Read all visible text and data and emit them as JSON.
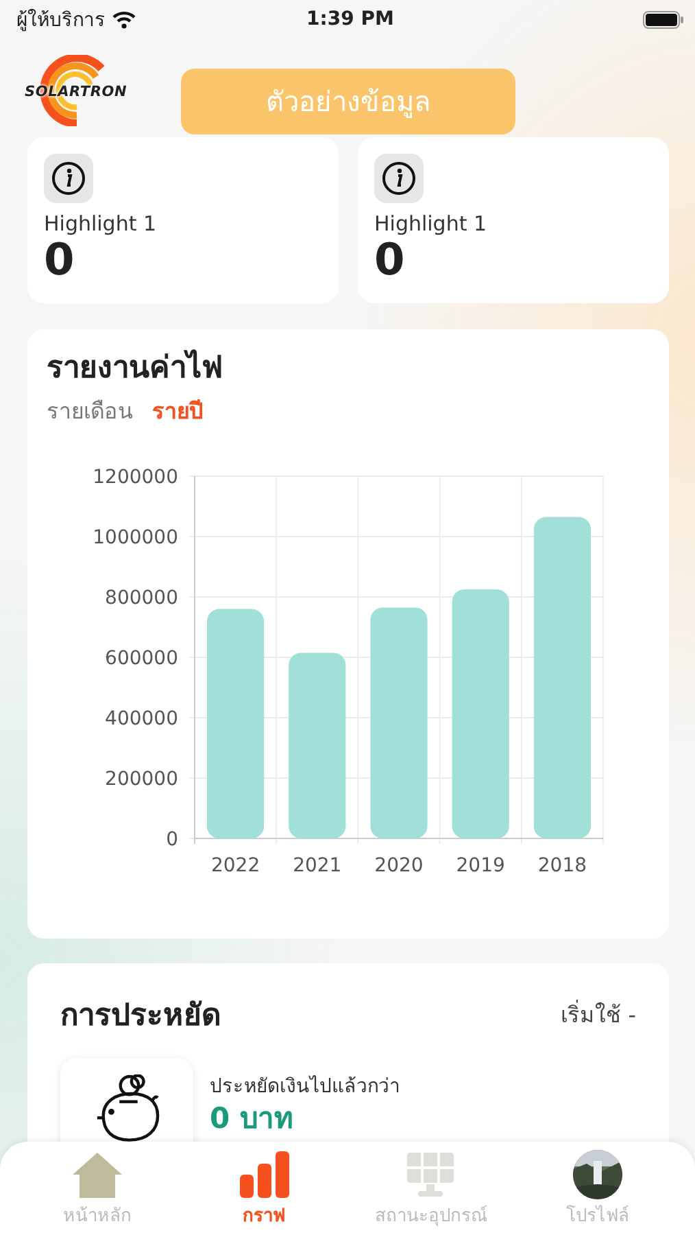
{
  "status_bar": {
    "carrier": "ผู้ให้บริการ",
    "time": "1:39 PM"
  },
  "header": {
    "logo": "SOLARTRON",
    "sample_button": "ตัวอย่างข้อมูล"
  },
  "highlights": [
    {
      "label": "Highlight 1",
      "value": "0"
    },
    {
      "label": "Highlight 1",
      "value": "0"
    }
  ],
  "report": {
    "title": "รายงานค่าไฟ",
    "tabs": [
      {
        "label": "รายเดือน",
        "selected": false
      },
      {
        "label": "รายปี",
        "selected": true
      }
    ],
    "chart_data": {
      "type": "bar",
      "categories": [
        "2022",
        "2021",
        "2020",
        "2019",
        "2018"
      ],
      "grid": true,
      "series": [
        {
          "color": "#a0e0d8",
          "values": [
            760000,
            615000,
            765000,
            825000,
            1065000
          ]
        }
      ],
      "ylim": [
        0,
        1200000
      ],
      "yticks": [
        0,
        200000,
        400000,
        600000,
        800000,
        1000000,
        1200000
      ]
    }
  },
  "savings": {
    "title": "การประหยัด",
    "since": "เริ่มใช้ -",
    "caption": "ประหยัดเงินไปแล้วกว่า",
    "amount": "0 บาท"
  },
  "tab_bar": [
    {
      "kind": "home",
      "label": "หน้าหลัก",
      "selected": false
    },
    {
      "kind": "graph",
      "label": "กราฟ",
      "selected": true
    },
    {
      "kind": "device",
      "label": "สถานะอุปกรณ์",
      "selected": false
    },
    {
      "kind": "profile",
      "label": "โปรไฟล์",
      "selected": false
    }
  ]
}
